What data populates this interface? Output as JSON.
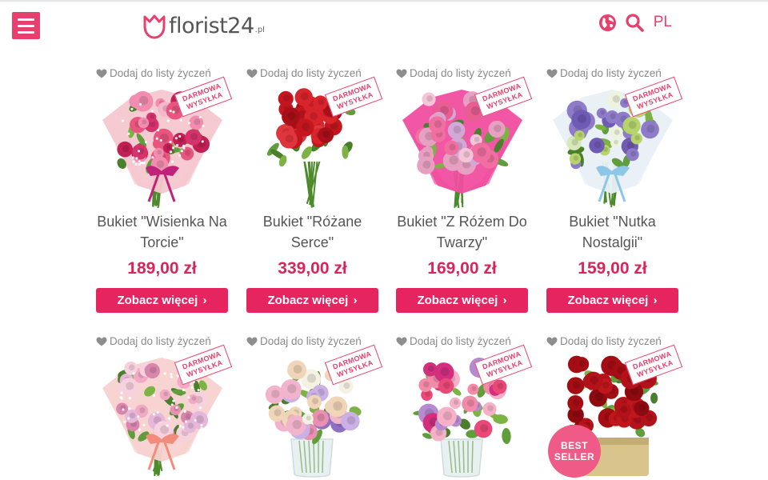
{
  "header": {
    "menu_icon": "hamburger-icon",
    "logo_text": "florist24",
    "logo_tld": ".pl",
    "globe_icon": "globe-icon",
    "search_icon": "search-icon",
    "language": "PL"
  },
  "colors": {
    "accent": "#e8406d",
    "button": "#e52460",
    "price": "#d8265a"
  },
  "products": [
    {
      "wishlist_label": "Dodaj do listy życzeń",
      "badge": "DARMOWA WYSYŁKA",
      "name": "Bukiet \"Wisienka Na Torcie\"",
      "price": "189,00 zł",
      "button": "Zobacz więcej",
      "palette": "pink-wrap"
    },
    {
      "wishlist_label": "Dodaj do listy życzeń",
      "badge": "DARMOWA WYSYŁKA",
      "name": "Bukiet \"Różane Serce\"",
      "price": "339,00 zł",
      "button": "Zobacz więcej",
      "palette": "red-roses"
    },
    {
      "wishlist_label": "Dodaj do listy życzeń",
      "badge": "DARMOWA WYSYŁKA",
      "name": "Bukiet \"Z Różem Do Twarzy\"",
      "price": "169,00 zł",
      "button": "Zobacz więcej",
      "palette": "hot-pink-wrap"
    },
    {
      "wishlist_label": "Dodaj do listy życzeń",
      "badge": "DARMOWA WYSYŁKA",
      "name": "Bukiet \"Nutka Nostalgii\"",
      "price": "159,00 zł",
      "button": "Zobacz więcej",
      "palette": "white-purple"
    },
    {
      "wishlist_label": "Dodaj do listy życzeń",
      "badge": "DARMOWA WYSYŁKA",
      "palette": "pastel-wrap"
    },
    {
      "wishlist_label": "Dodaj do listy życzeń",
      "badge": "DARMOWA WYSYŁKA",
      "palette": "vase-pastel"
    },
    {
      "wishlist_label": "Dodaj do listy życzeń",
      "badge": "DARMOWA WYSYŁKA",
      "palette": "vase-pink"
    },
    {
      "wishlist_label": "Dodaj do listy życzeń",
      "badge": "DARMOWA WYSYŁKA",
      "badge2": "BEST SELLER",
      "palette": "red-box"
    }
  ]
}
